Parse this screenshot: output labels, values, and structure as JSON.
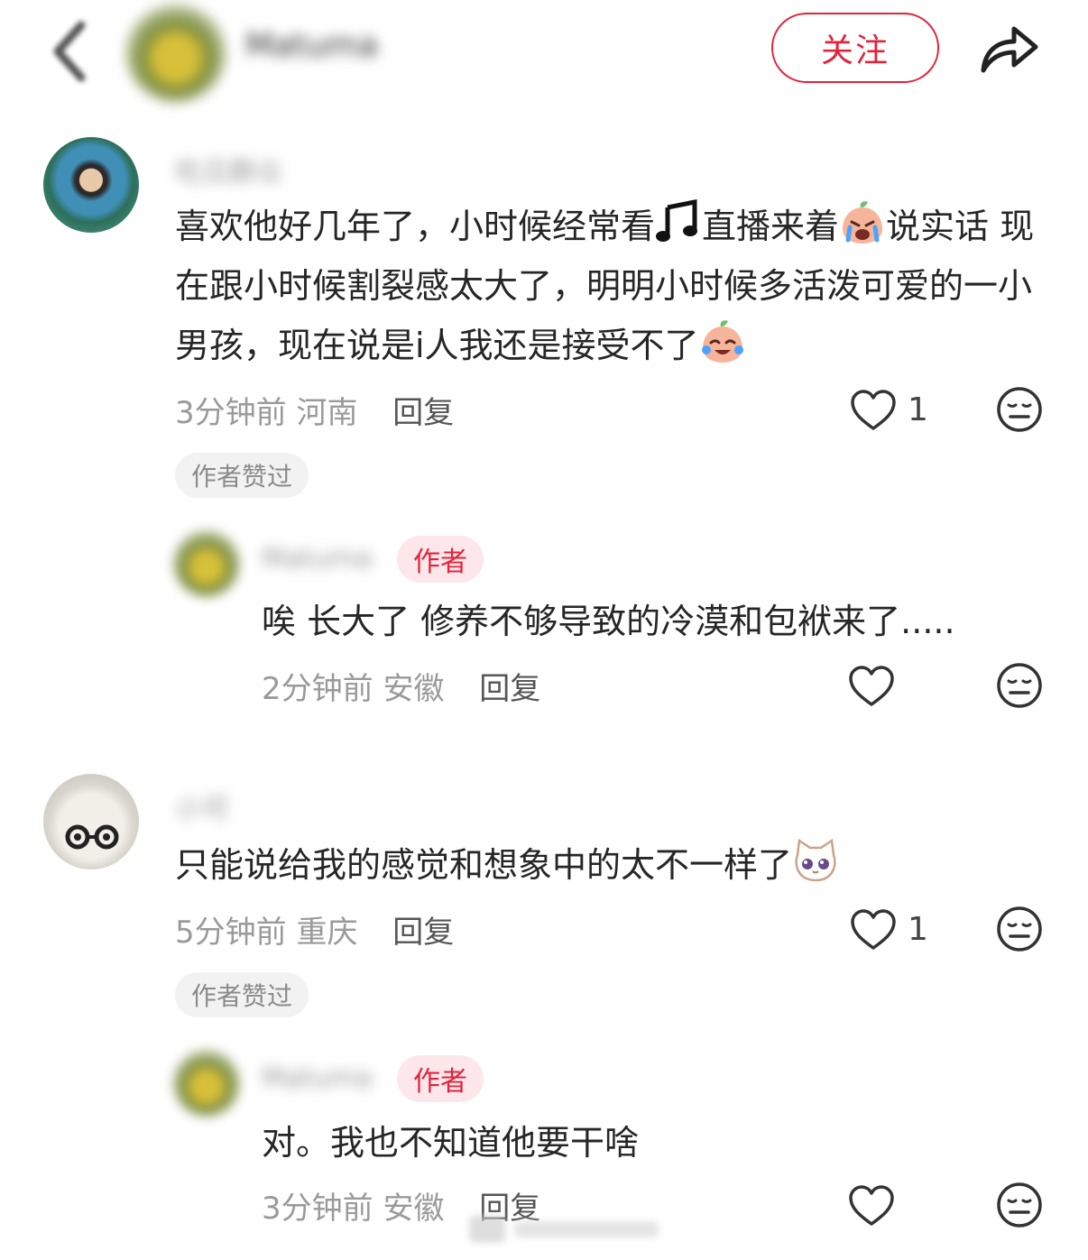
{
  "header": {
    "author_name": "Matuma",
    "follow_label": "关注",
    "share_icon": "share-icon",
    "back_icon": "back-icon"
  },
  "comments": [
    {
      "user_name": "吃瓜群众",
      "text_parts": [
        "喜欢他好几年了，小时候经常看",
        "直播来着",
        "说实话 现在跟小时候割裂感太大了，明明小时候多活泼可爱的一小男孩，现在说是i人我还是接受不了"
      ],
      "time": "3分钟前",
      "location": "河南",
      "reply_label": "回复",
      "likes": "1",
      "liked_badge": "作者赞过",
      "replies": [
        {
          "user_name": "Matuma",
          "author_badge": "作者",
          "text": "唉 长大了 修养不够导致的冷漠和包袱来了.....",
          "time": "2分钟前",
          "location": "安徽",
          "reply_label": "回复"
        }
      ]
    },
    {
      "user_name": "小可",
      "text": "只能说给我的感觉和想象中的太不一样了",
      "time": "5分钟前",
      "location": "重庆",
      "reply_label": "回复",
      "likes": "1",
      "liked_badge": "作者赞过",
      "replies": [
        {
          "user_name": "Matuma",
          "author_badge": "作者",
          "text": "对。我也不知道他要干啥",
          "time": "3分钟前",
          "location": "安徽",
          "reply_label": "回复"
        }
      ]
    }
  ],
  "colors": {
    "accent": "#e0243c",
    "author_badge_bg": "#fde7ea",
    "meta_text": "#9a9a9a"
  }
}
